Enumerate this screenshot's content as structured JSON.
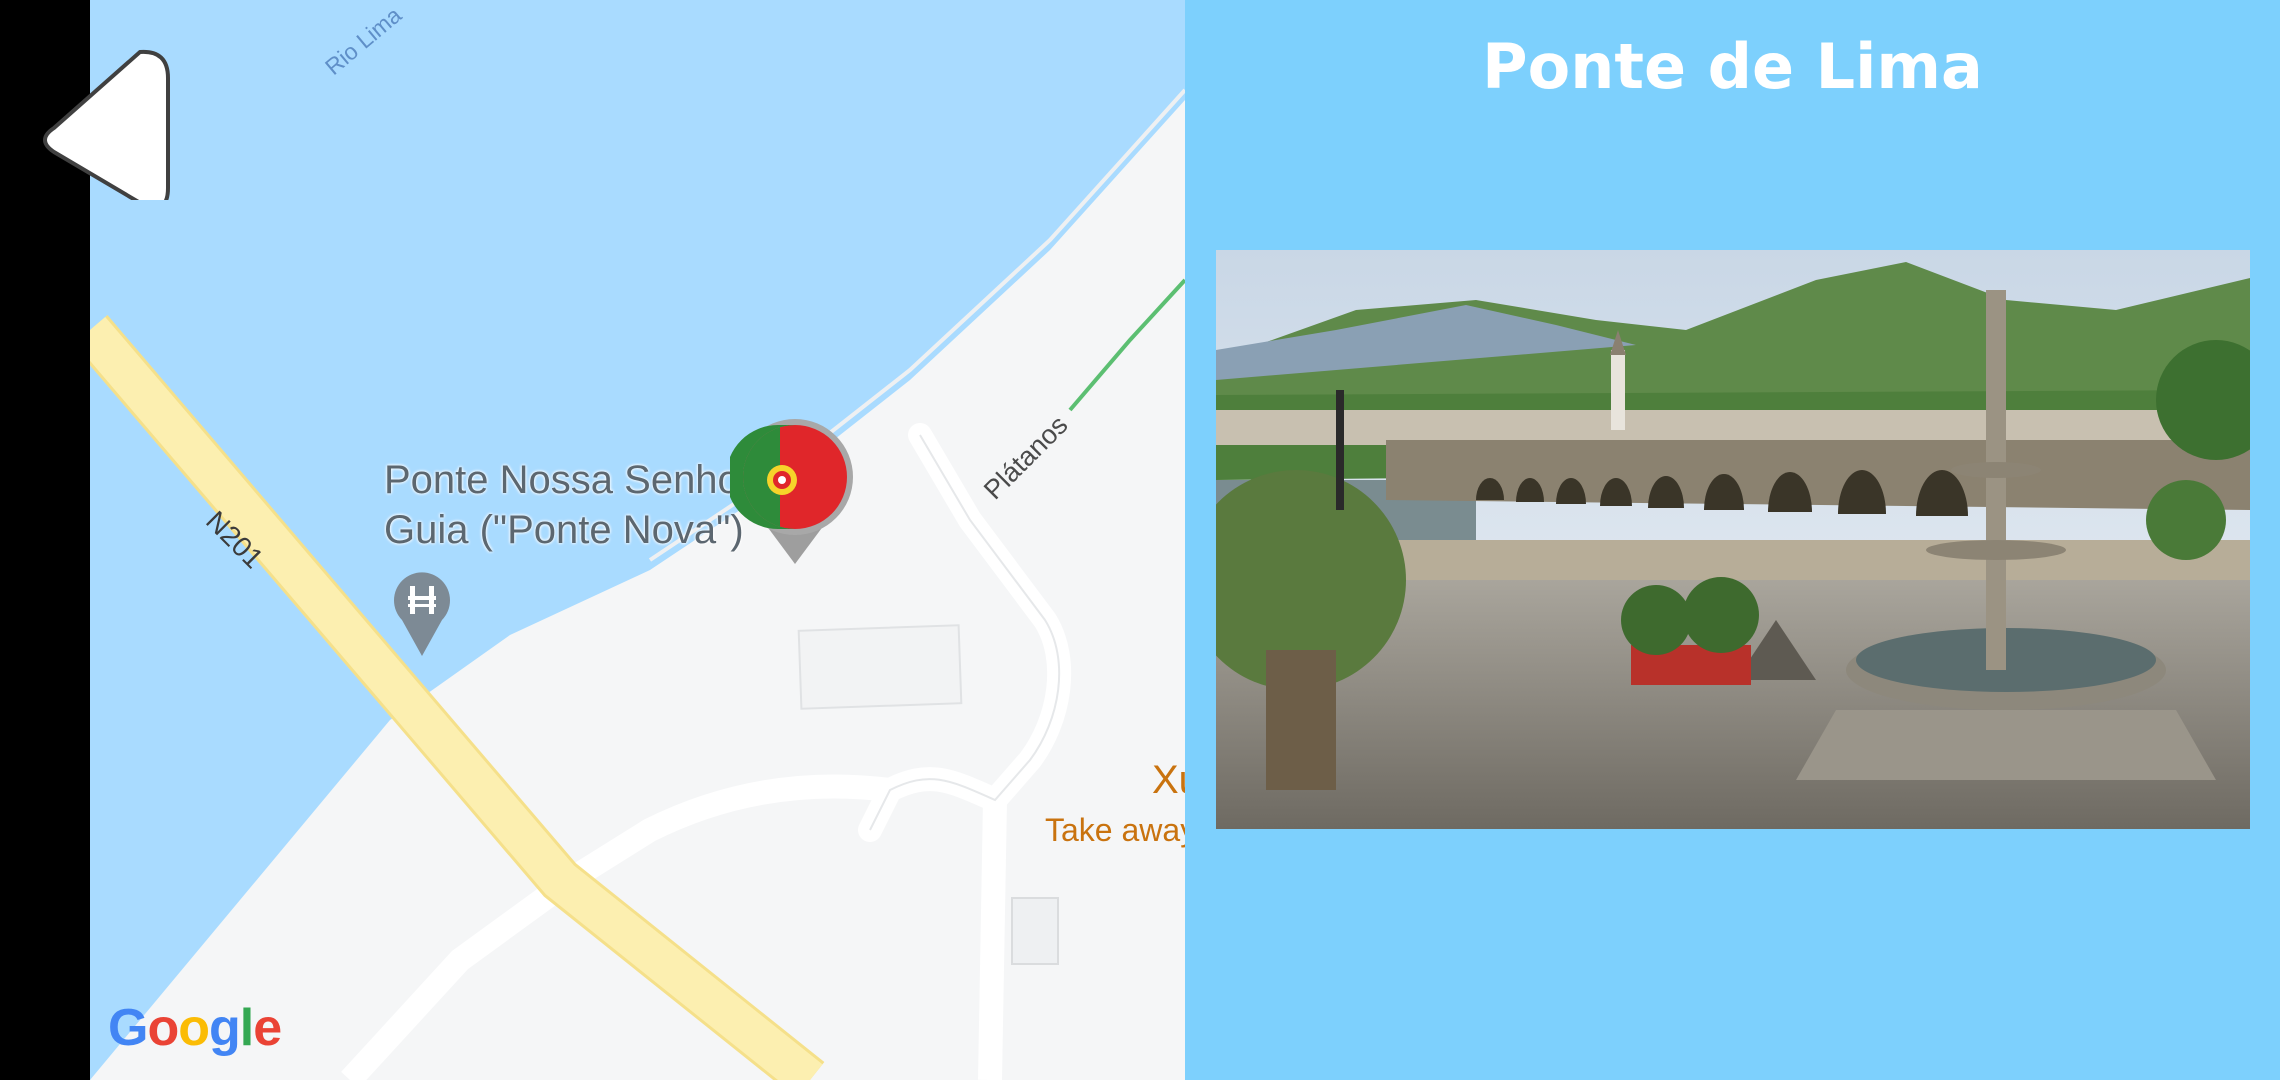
{
  "map": {
    "river_label": "Rio Lima",
    "road_label": "N201",
    "street_label": "Plátanos",
    "poi_name_line1": "Ponte Nossa Senhora da",
    "poi_name_line2": "Guia (\"Ponte Nova\")",
    "restaurant_name": "Xu",
    "restaurant_type": "Take away",
    "attribution": "Google",
    "colors": {
      "water": "#a9dbff",
      "land": "#f5f6f7",
      "road": "#fcefb0",
      "label_orange": "#c9730f"
    }
  },
  "back_button": {
    "icon": "back-triangle-icon"
  },
  "flag_marker": {
    "icon": "portugal-flag-icon"
  },
  "bridge_marker": {
    "icon": "bridge-icon"
  },
  "panel": {
    "title": "Ponte de Lima",
    "background": "#7dd0fd",
    "photo": {
      "description_icon": "ponte-de-lima-photo"
    }
  }
}
